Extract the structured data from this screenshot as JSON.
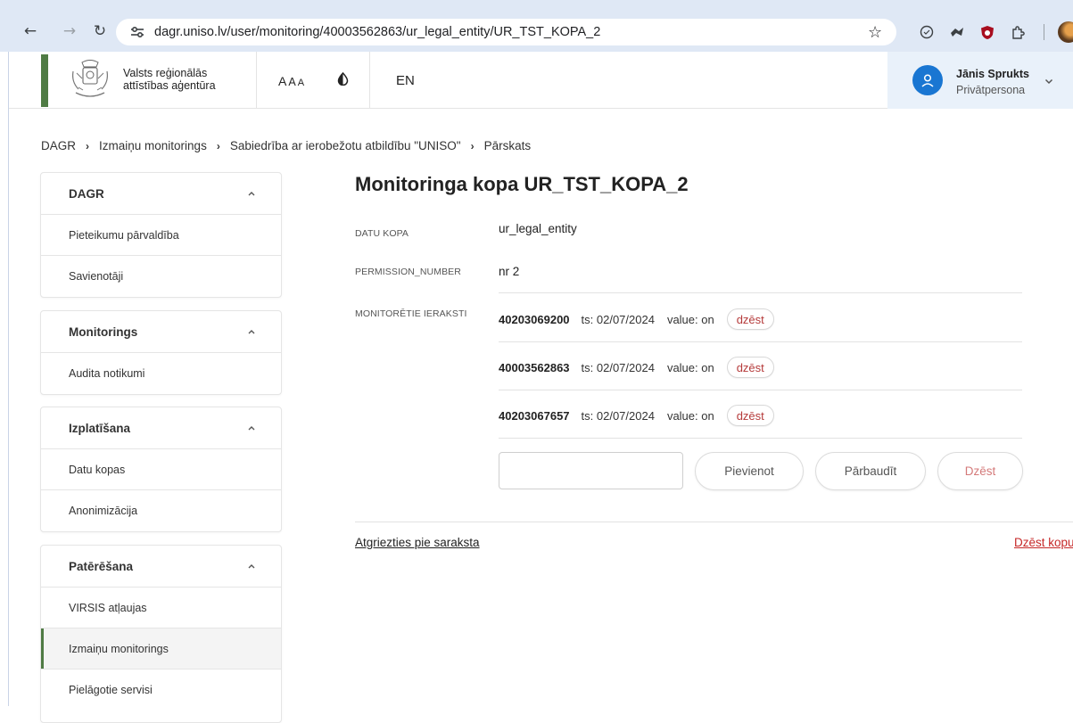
{
  "browser": {
    "url": "dagr.uniso.lv/user/monitoring/40003562863/ur_legal_entity/UR_TST_KOPA_2"
  },
  "header": {
    "org_name": "Valsts reģionālās\nattīstības aģentūra",
    "font_size_labels": [
      "A",
      "A",
      "A"
    ],
    "language": "EN",
    "user": {
      "name": "Jānis Sprukts",
      "role": "Privātpersona"
    }
  },
  "breadcrumb": [
    "DAGR",
    "Izmaiņu monitorings",
    "Sabiedrība ar ierobežotu atbildību \"UNISO\"",
    "Pārskats"
  ],
  "sidebar": {
    "groups": [
      {
        "title": "DAGR",
        "items": [
          "Pieteikumu pārvaldība",
          "Savienotāji"
        ]
      },
      {
        "title": "Monitorings",
        "items": [
          "Audita notikumi"
        ]
      },
      {
        "title": "Izplatīšana",
        "items": [
          "Datu kopas",
          "Anonimizācija"
        ]
      },
      {
        "title": "Patērēšana",
        "items": [
          "VIRSIS atļaujas",
          "Izmaiņu monitorings",
          "Pielāgotie servisi"
        ],
        "active_item": "Izmaiņu monitorings"
      }
    ]
  },
  "main": {
    "title": "Monitoringa kopa UR_TST_KOPA_2",
    "fields": {
      "dataset_label": "DATU KOPA",
      "dataset_value": "ur_legal_entity",
      "permission_label": "PERMISSION_NUMBER",
      "permission_value": "nr 2",
      "records_label": "MONITORĒTIE IERAKSTI"
    },
    "records": [
      {
        "id": "40203069200",
        "ts": "ts: 02/07/2024",
        "value": "value: on",
        "delete_label": "dzēst"
      },
      {
        "id": "40003562863",
        "ts": "ts: 02/07/2024",
        "value": "value: on",
        "delete_label": "dzēst"
      },
      {
        "id": "40203067657",
        "ts": "ts: 02/07/2024",
        "value": "value: on",
        "delete_label": "dzēst"
      }
    ],
    "input_value": "",
    "buttons": {
      "add": "Pievienot",
      "check": "Pārbaudīt",
      "delete": "Dzēst"
    },
    "back_link": "Atgriezties pie saraksta",
    "delete_set_link": "Dzēst kopu"
  },
  "colors": {
    "brand_green": "#4f7b44",
    "accent_blue": "#1976d2",
    "danger_red": "#c62828"
  }
}
